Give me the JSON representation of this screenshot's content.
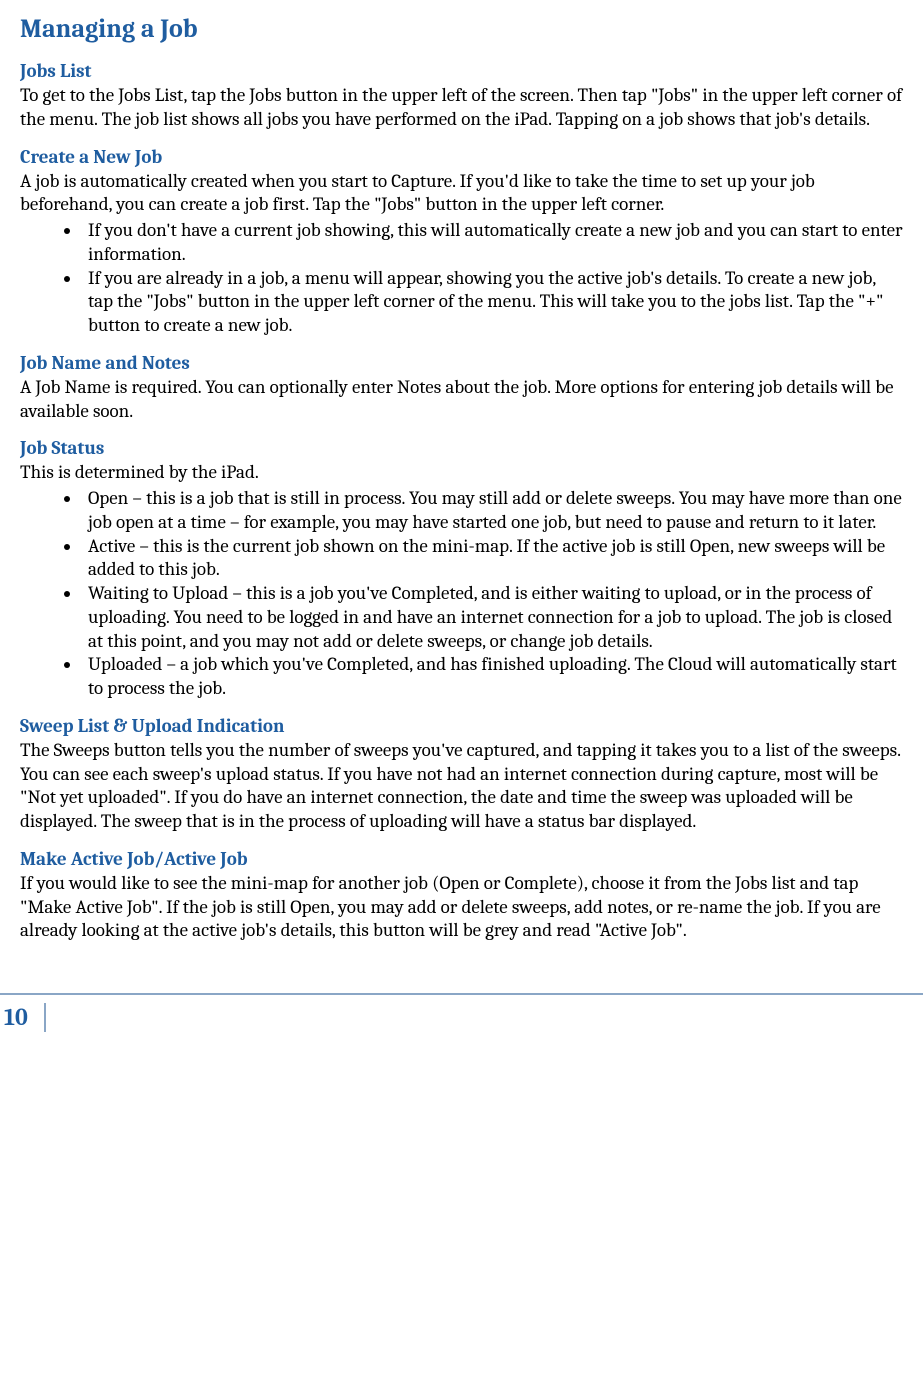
{
  "title": "Managing a Job",
  "sections": {
    "jobs_list": {
      "heading": "Jobs List",
      "body": "To get to the Jobs List, tap the Jobs button in the upper left of the screen.  Then tap \"Jobs\" in the upper left corner of the menu.  The job list shows all jobs you have performed on the iPad.  Tapping on a job shows that job's details."
    },
    "create_job": {
      "heading": "Create a New Job",
      "body": "A job is automatically created when you start to Capture.  If you'd like to take the time to set up your job beforehand, you can create a job first.  Tap the \"Jobs\" button in the upper left corner.",
      "bullets": [
        "If you don't have a current job showing, this will automatically create a new job and you can start to enter information.",
        "If you are already in a job, a menu will appear, showing you the active job's details.  To create a new job, tap the \"Jobs\" button in the upper left corner of the menu.  This will take you to the jobs list.  Tap the \"+\" button to create a new job."
      ]
    },
    "job_name": {
      "heading": "Job Name and Notes",
      "body": "A Job Name is required.  You can optionally enter Notes about the job.  More options for entering job details will be available soon."
    },
    "job_status": {
      "heading": "Job Status",
      "body": "This is determined by the iPad.",
      "bullets": [
        "Open – this is a job that is still in process.  You may still add or delete sweeps.  You may have more than one job open at a time – for example, you may have started one job, but need to pause and return to it later.",
        "Active – this is the current job shown on the mini-map.  If the active job is still Open, new sweeps will be added to this job.",
        "Waiting to Upload – this is a job you've Completed, and is either waiting to upload, or in the process of uploading.  You need to be logged in and have an internet connection for a job to upload.  The job is closed at this point, and you may not add or delete sweeps, or change job details.",
        "Uploaded – a job which you've Completed, and has finished uploading.  The Cloud will automatically start to process the job."
      ]
    },
    "sweep_list": {
      "heading": "Sweep List & Upload Indication",
      "body": "The Sweeps button tells you the number of sweeps you've captured, and tapping it takes you to a list of the sweeps.  You can see each sweep's upload status.  If you have not had an internet connection during capture, most will be \"Not yet uploaded\".  If you do have an internet connection, the date and time the sweep was uploaded will be displayed.  The sweep that is in the process of uploading will have a status bar displayed."
    },
    "active_job": {
      "heading": "Make Active Job/Active Job",
      "body": "If you would like to see the mini-map for another job (Open or Complete), choose it from the Jobs list and tap \"Make Active Job\".  If the job is still Open, you may add or delete sweeps, add notes, or re-name the job.  If you are already looking at the active job's details, this button will be grey and read \"Active Job\"."
    }
  },
  "page_number": "10"
}
